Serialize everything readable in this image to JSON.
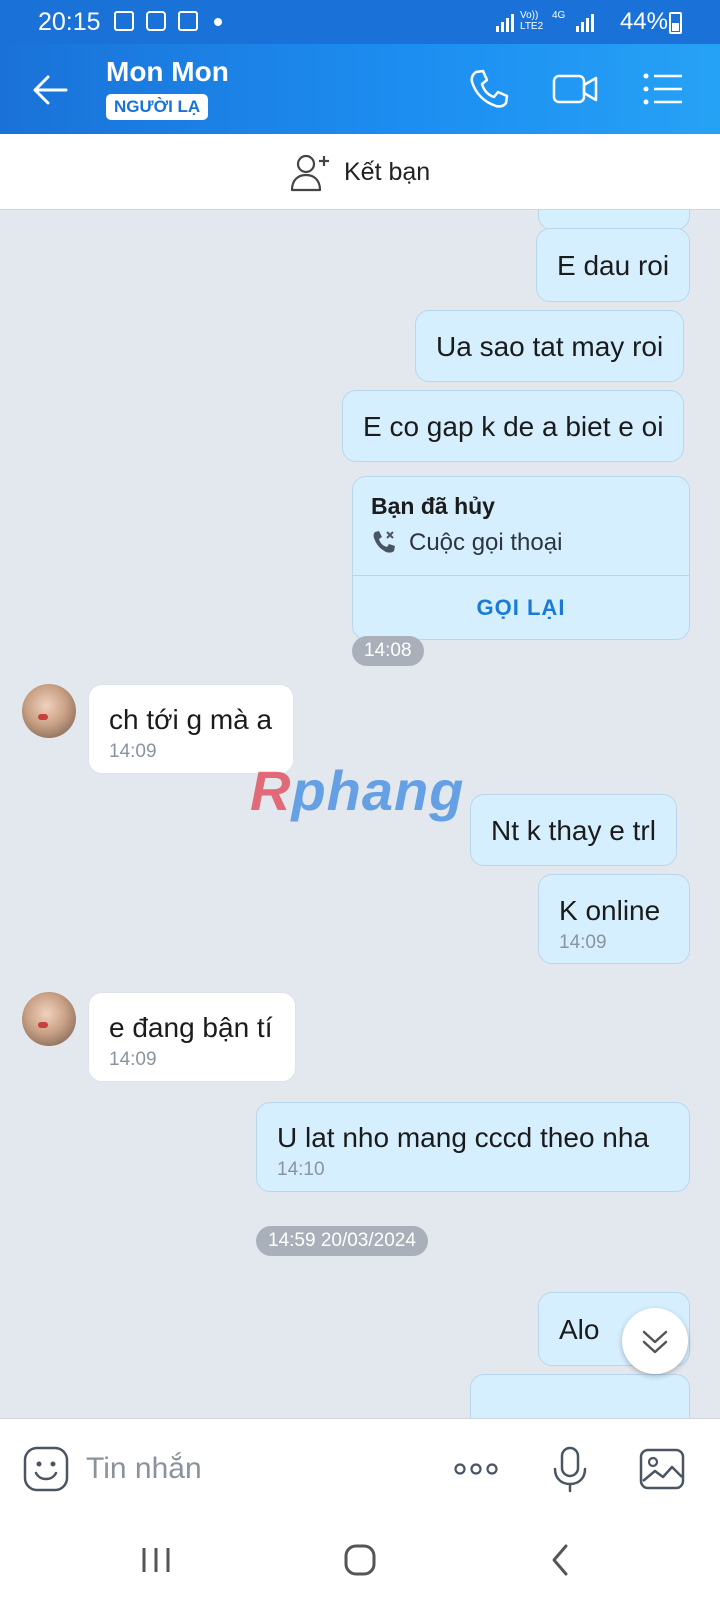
{
  "status_bar": {
    "time": "20:15",
    "battery": "44%",
    "network_top": "Vo))",
    "network_bottom": "LTE2",
    "network_type": "4G",
    "icons": [
      "gallery-icon",
      "zalo-icon",
      "app-icon"
    ]
  },
  "header": {
    "name": "Mon Mon",
    "badge": "NGƯỜI LẠ",
    "color": "#1a72d8"
  },
  "add_friend": {
    "label": "Kết bạn"
  },
  "messages": [
    {
      "dir": "sent",
      "text": "E dau roi"
    },
    {
      "dir": "sent",
      "text": "Ua sao tat may roi"
    },
    {
      "dir": "sent",
      "text": "E co gap k de a biet e oi"
    }
  ],
  "call_card": {
    "title": "Bạn đã hủy",
    "subtitle": "Cuộc gọi thoại",
    "action": "GỌI LẠI",
    "time": "14:08"
  },
  "messages2": [
    {
      "dir": "recv",
      "text": "ch tới g mà a",
      "time": "14:09"
    },
    {
      "dir": "sent",
      "text": "Nt k thay e trl"
    },
    {
      "dir": "sent",
      "text": "K online",
      "time": "14:09"
    },
    {
      "dir": "recv",
      "text": "e đang bận tí",
      "time": "14:09"
    },
    {
      "dir": "sent",
      "text": "U lat nho mang cccd theo nha",
      "time": "14:10"
    }
  ],
  "date_separator": "14:59 20/03/2024",
  "messages3": [
    {
      "dir": "sent",
      "text": "Alo"
    }
  ],
  "watermark": {
    "first": "R",
    "rest": "phang"
  },
  "input": {
    "placeholder": "Tin nhắn"
  }
}
